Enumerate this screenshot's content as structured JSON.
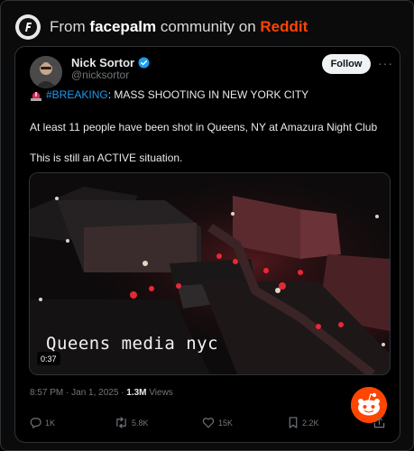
{
  "embed": {
    "prefix": "From",
    "community": "facepalm",
    "middle": "community on",
    "platform": "Reddit"
  },
  "tweet": {
    "author_name": "Nick Sortor",
    "author_handle": "@nicksortor",
    "follow_label": "Follow",
    "more_label": "···",
    "hashtag": "#BREAKING",
    "headline_rest": ": MASS SHOOTING IN NEW YORK CITY",
    "line2": "At least 11 people have been shot in Queens, NY at Amazura Night Club",
    "line3": "This is still an ACTIVE situation.",
    "video_caption": "Queens media nyc",
    "video_duration": "0:37",
    "timestamp": "8:57 PM · Jan 1, 2025 · ",
    "views_count": "1.3M",
    "views_label": " Views",
    "replies": "1K",
    "reposts": "5.8K",
    "likes": "15K",
    "bookmarks": "2.2K"
  },
  "colors": {
    "accent": "#1d9bf0",
    "reddit": "#ff4500",
    "text": "#e7e9ea",
    "muted": "#71767b"
  },
  "icons": [
    "facepalm-logo-icon",
    "verified-badge-icon",
    "siren-icon",
    "reply-icon",
    "repost-icon",
    "like-icon",
    "bookmark-icon",
    "share-icon",
    "reddit-snoo-icon"
  ]
}
